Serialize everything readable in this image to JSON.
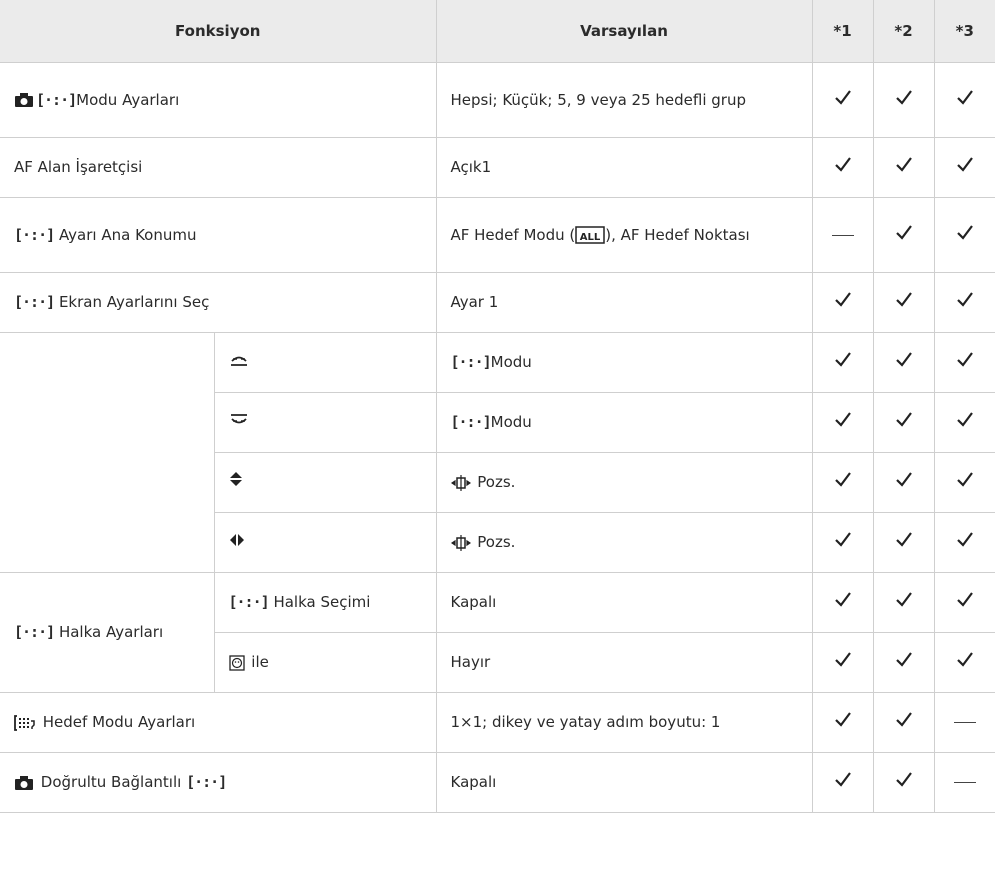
{
  "header": {
    "col1": "Fonksiyon",
    "col2": "Varsayılan",
    "c1": "*1",
    "c2": "*2",
    "c3": "*3"
  },
  "rows": [
    {
      "label": "Modu Ayarları",
      "default": "Hepsi; Küçük; 5, 9 veya 25 hedefli grup",
      "marks": [
        "check",
        "check",
        "check"
      ]
    },
    {
      "label": "AF Alan İşaretçisi",
      "default": "Açık1",
      "marks": [
        "check",
        "check",
        "check"
      ]
    },
    {
      "label": "Ayarı Ana Konumu",
      "default": "AF Hedef Modu (",
      "default_after": "), AF Hedef Noktası",
      "marks": [
        "dash",
        "check",
        "check"
      ]
    },
    {
      "label": "Ekran Ayarlarını Seç",
      "default": "Ayar 1",
      "marks": [
        "check",
        "check",
        "check"
      ]
    },
    {
      "sub_icon": "front-dial-icon",
      "default": "Modu",
      "marks": [
        "check",
        "check",
        "check"
      ]
    },
    {
      "sub_icon": "rear-dial-icon",
      "default": "Modu",
      "marks": [
        "check",
        "check",
        "check"
      ]
    },
    {
      "sub_icon": "up-down-arrows-icon",
      "default": "Pozs.",
      "marks": [
        "check",
        "check",
        "check"
      ]
    },
    {
      "sub_icon": "left-right-arrows-icon",
      "default": "Pozs.",
      "marks": [
        "check",
        "check",
        "check"
      ]
    },
    {
      "group": "Halka Ayarları",
      "sub": "Halka Seçimi",
      "default": "Kapalı",
      "marks": [
        "check",
        "check",
        "check"
      ]
    },
    {
      "sub": "ile",
      "default": "Hayır",
      "marks": [
        "check",
        "check",
        "check"
      ]
    },
    {
      "label": "Hedef Modu Ayarları",
      "default": "1×1; dikey ve yatay adım boyutu: 1",
      "marks": [
        "check",
        "check",
        "dash"
      ]
    },
    {
      "label": "Doğrultu Bağlantılı",
      "default": "Kapalı",
      "marks": [
        "check",
        "check",
        "dash"
      ]
    }
  ]
}
